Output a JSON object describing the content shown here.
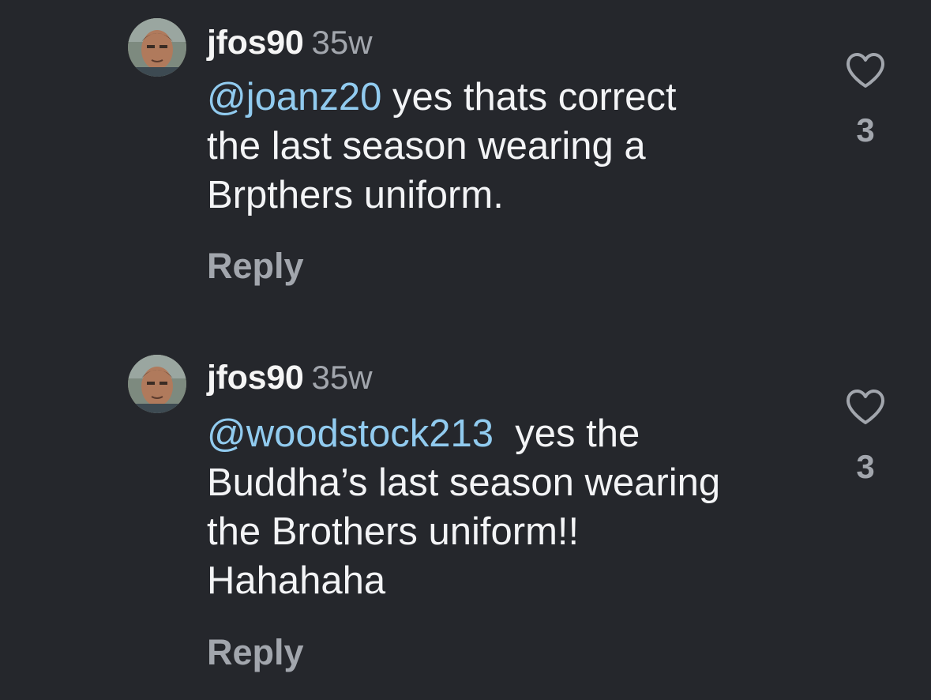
{
  "comments": [
    {
      "username": "jfos90",
      "timestamp": "35w",
      "lines": [
        {
          "mention": "@joanz20",
          "text": " yes thats correct"
        },
        {
          "mention": "",
          "text": "the last season wearing a"
        },
        {
          "mention": "",
          "text": "Brpthers uniform."
        }
      ],
      "reply_label": "Reply",
      "like_count": "3",
      "avatar_icon": "user-avatar-photo",
      "like_icon": "heart-outline-icon"
    },
    {
      "username": "jfos90",
      "timestamp": "35w",
      "lines": [
        {
          "mention": "@woodstock213",
          "text": "  yes the"
        },
        {
          "mention": "",
          "text": "Buddha’s last season wearing"
        },
        {
          "mention": "",
          "text": "the Brothers uniform!!"
        },
        {
          "mention": "",
          "text": "Hahahaha"
        }
      ],
      "reply_label": "Reply",
      "like_count": "3",
      "avatar_icon": "user-avatar-photo",
      "like_icon": "heart-outline-icon"
    }
  ],
  "colors": {
    "background": "#25272c",
    "text": "#f3f4f6",
    "mention": "#91cbef",
    "muted": "#a2a6ad"
  }
}
